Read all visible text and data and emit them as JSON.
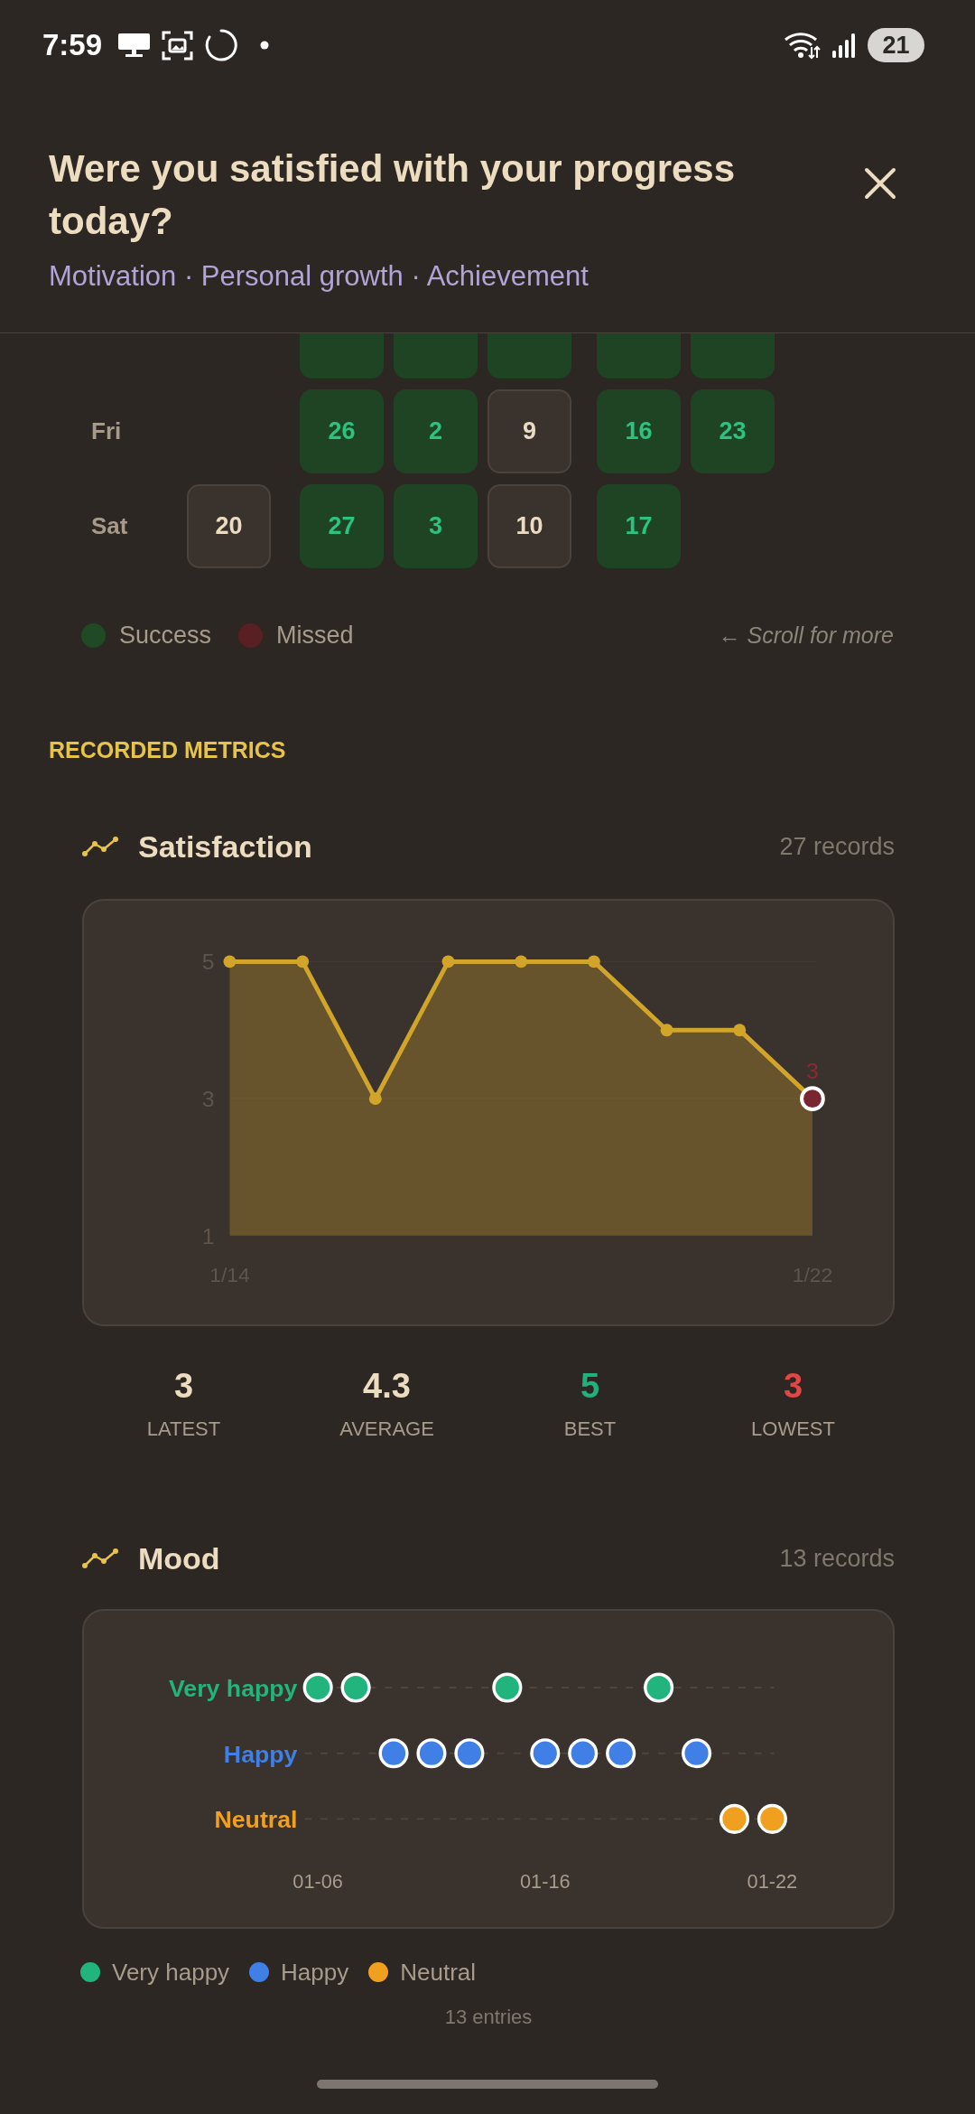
{
  "status_bar": {
    "time": "7:59",
    "battery": "21"
  },
  "prompt": {
    "title": "Were you satisfied with your progress today?",
    "tags": "Motivation · Personal growth · Achievement"
  },
  "calendar": {
    "rows": [
      {
        "cells": [
          {
            "kind": "blank"
          },
          {
            "kind": "success"
          },
          {
            "kind": "success"
          },
          {
            "kind": "success"
          },
          {
            "kind": "success"
          },
          {
            "kind": "success"
          }
        ]
      },
      {
        "day": "Fri",
        "cells": [
          {
            "kind": "blank"
          },
          {
            "date": "26",
            "kind": "success"
          },
          {
            "date": "2",
            "kind": "success"
          },
          {
            "date": "9",
            "kind": "unrecorded"
          },
          {
            "date": "16",
            "kind": "success"
          },
          {
            "date": "23",
            "kind": "success"
          }
        ]
      },
      {
        "day": "Sat",
        "cells": [
          {
            "date": "20",
            "kind": "unrecorded"
          },
          {
            "date": "27",
            "kind": "success"
          },
          {
            "date": "3",
            "kind": "success"
          },
          {
            "date": "10",
            "kind": "unrecorded"
          },
          {
            "date": "17",
            "kind": "success"
          },
          {
            "kind": "blank"
          }
        ]
      }
    ],
    "legend": [
      {
        "label": "Success",
        "color": "#1f4a25"
      },
      {
        "label": "Missed",
        "color": "#5a1f22"
      }
    ],
    "scroll_hint": "← Scroll for more"
  },
  "section_title": "RECORDED METRICS",
  "metrics": [
    {
      "kind": "line",
      "name": "Satisfaction",
      "count": "27 records",
      "chart_data": {
        "type": "area",
        "ylim": [
          1,
          5
        ],
        "yticks": [
          1,
          3,
          5
        ],
        "categories": [
          "1/14",
          null,
          null,
          null,
          null,
          null,
          null,
          null,
          "1/22"
        ],
        "series": [
          {
            "color": "#d1a52a",
            "values": [
              5,
              5,
              3,
              5,
              5,
              5,
              4,
              4,
              3
            ]
          }
        ],
        "annotations": [
          {
            "x": "1/22",
            "y": 3,
            "text": "3"
          }
        ]
      },
      "stats": [
        {
          "value": "3",
          "label": "LATEST",
          "color": "#ecdcc0"
        },
        {
          "value": "4.3",
          "label": "AVERAGE",
          "color": "#ecdcc0"
        },
        {
          "value": "5",
          "label": "BEST",
          "color": "#22b07d"
        },
        {
          "value": "3",
          "label": "LOWEST",
          "color": "#e04848"
        }
      ]
    },
    {
      "kind": "dots",
      "name": "Mood",
      "count": "13 records",
      "mood_plot": {
        "rows": [
          {
            "kind": "very_happy",
            "label": "Very happy",
            "color": "#21b47c"
          },
          {
            "kind": "happy",
            "label": "Happy",
            "color": "#3f7fe6"
          },
          {
            "kind": "neutral",
            "label": "Neutral",
            "color": "#f0a01e"
          }
        ],
        "entries": [
          {
            "kind": "very_happy"
          },
          {
            "kind": "very_happy"
          },
          {
            "kind": "happy"
          },
          {
            "kind": "happy"
          },
          {
            "kind": "happy"
          },
          {
            "kind": "very_happy"
          },
          {
            "kind": "happy"
          },
          {
            "kind": "happy"
          },
          {
            "kind": "happy"
          },
          {
            "kind": "very_happy"
          },
          {
            "kind": "happy"
          },
          {
            "kind": "neutral"
          },
          {
            "kind": "neutral"
          }
        ],
        "date_labels": [
          "01-06",
          "01-16",
          "01-22"
        ]
      },
      "legend": [
        {
          "label": "Very happy",
          "color": "#21b47c"
        },
        {
          "label": "Happy",
          "color": "#3f7fe6"
        },
        {
          "label": "Neutral",
          "color": "#f0a01e"
        }
      ],
      "footer": "13 entries"
    }
  ]
}
